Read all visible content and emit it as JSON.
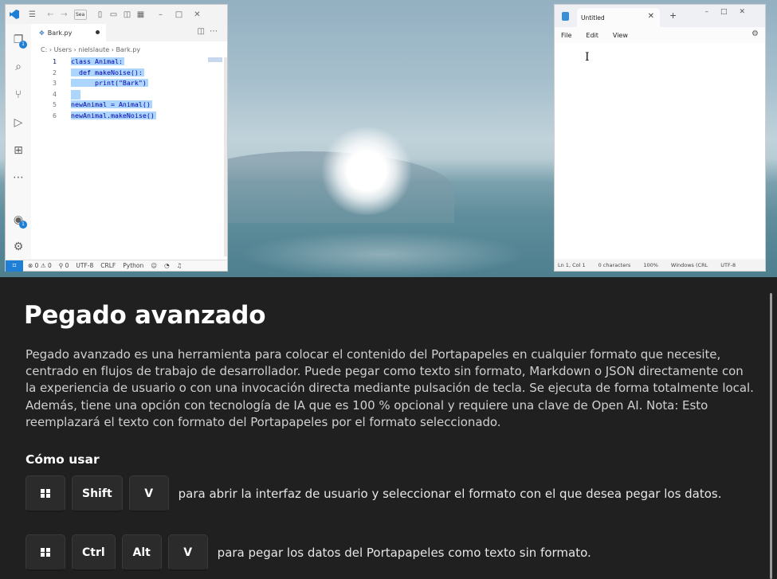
{
  "vscode": {
    "search_stub": "Sea",
    "tab_name": "Bark.py",
    "breadcrumb": [
      "C:",
      "Users",
      "nielslaute",
      "Bark.py"
    ],
    "badge_count": "1",
    "account_badge_count": "1",
    "lines": [
      {
        "n": "1",
        "text": "class Animal:"
      },
      {
        "n": "2",
        "text": "  def makeNoise():"
      },
      {
        "n": "3",
        "text": "      print(\"Bark\")"
      },
      {
        "n": "4",
        "text": ""
      },
      {
        "n": "5",
        "text": "newAnimal = Animal()"
      },
      {
        "n": "6",
        "text": "newAnimal.makeNoise()"
      }
    ],
    "status": {
      "errors": "0",
      "warnings": "0",
      "ports": "0",
      "encoding": "UTF-8",
      "eol": "CRLF",
      "language": "Python"
    }
  },
  "notepad": {
    "tab_title": "Untitled",
    "menu": [
      "File",
      "Edit",
      "View"
    ],
    "status": {
      "position": "Ln 1, Col 1",
      "characters": "0 characters",
      "zoom": "100%",
      "line_endings": "Windows (CRL",
      "encoding": "UTF-8"
    }
  },
  "article": {
    "title": "Pegado avanzado",
    "description": "Pegado avanzado es una herramienta para colocar el contenido del Portapapeles en cualquier formato que necesite, centrado en flujos de trabajo de desarrollador. Puede pegar como texto sin formato, Markdown o JSON directamente con la experiencia de usuario o con una invocación directa mediante pulsación de tecla. Se ejecuta de forma totalmente local. Además, tiene una opción con tecnología de IA que es 100 % opcional y requiere una clave de Open AI. Nota: Esto reemplazará el texto con formato del Portapapeles por el formato seleccionado.",
    "how_to_heading": "Cómo usar",
    "shortcut1": {
      "keys": [
        "Shift",
        "V"
      ],
      "text": "para abrir la interfaz de usuario y seleccionar el formato con el que desea pegar los datos."
    },
    "shortcut2": {
      "keys": [
        "Ctrl",
        "Alt",
        "V"
      ],
      "text": "para pegar los datos del Portapapeles como texto sin formato."
    }
  },
  "colors": {
    "background": "#202020",
    "accent": "#1e7fd4",
    "selection": "#add6ff"
  }
}
